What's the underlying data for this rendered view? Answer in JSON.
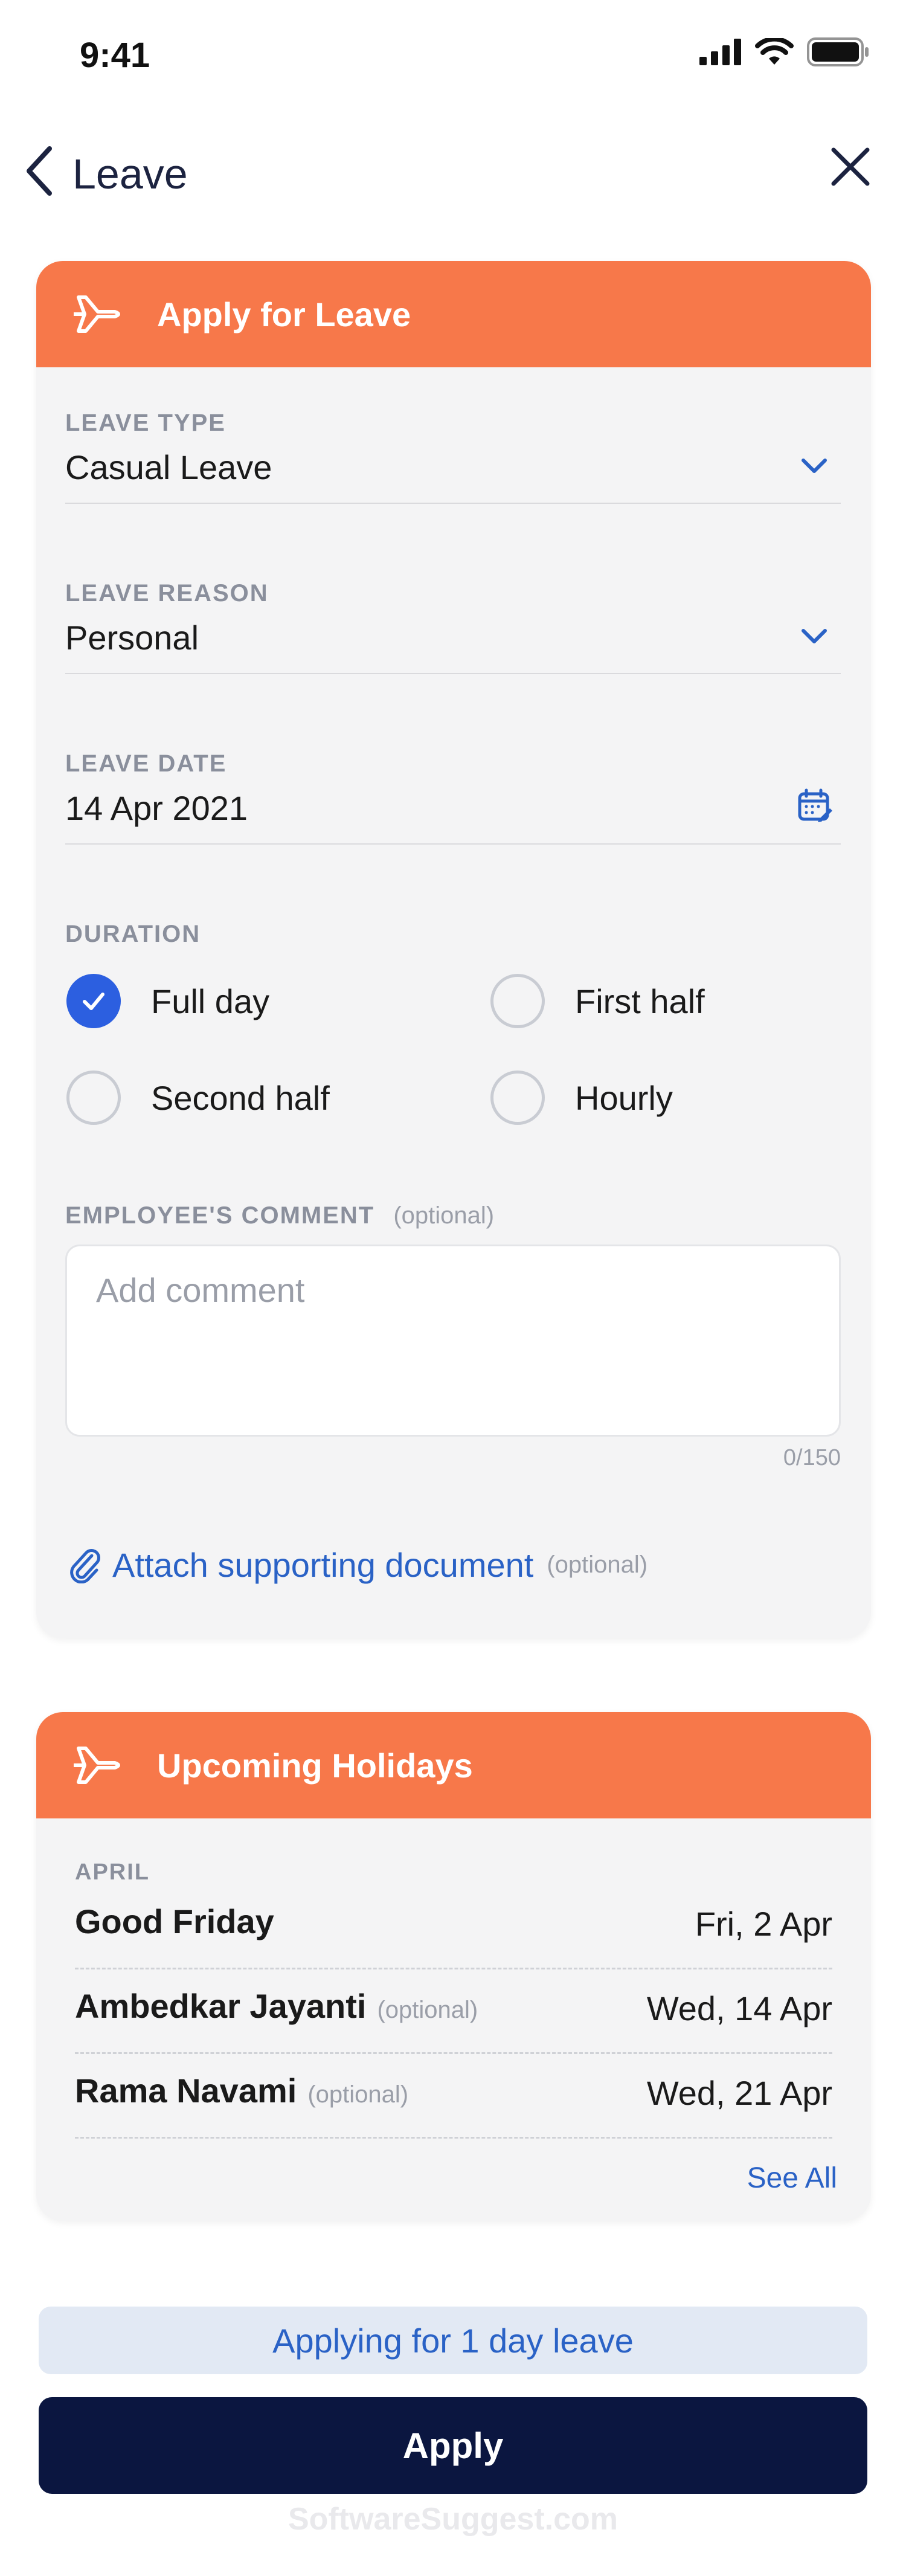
{
  "status_bar": {
    "time": "9:41"
  },
  "nav": {
    "title": "Leave"
  },
  "apply_card": {
    "title": "Apply for Leave",
    "leave_type": {
      "label": "LEAVE TYPE",
      "value": "Casual Leave"
    },
    "leave_reason": {
      "label": "LEAVE REASON",
      "value": "Personal"
    },
    "leave_date": {
      "label": "LEAVE DATE",
      "value": "14 Apr 2021"
    },
    "duration": {
      "label": "DURATION",
      "options": [
        {
          "label": "Full day",
          "checked": true
        },
        {
          "label": "First half",
          "checked": false
        },
        {
          "label": "Second half",
          "checked": false
        },
        {
          "label": "Hourly",
          "checked": false
        }
      ]
    },
    "comment": {
      "label": "EMPLOYEE'S COMMENT",
      "optional": "(optional)",
      "placeholder": "Add comment",
      "count": "0/150"
    },
    "attach": {
      "label": "Attach supporting document",
      "optional": "(optional)"
    }
  },
  "holidays_card": {
    "title": "Upcoming Holidays",
    "month": "APRIL",
    "items": [
      {
        "name": "Good Friday",
        "optional": "",
        "date": "Fri, 2 Apr"
      },
      {
        "name": "Ambedkar Jayanti",
        "optional": "(optional)",
        "date": "Wed, 14 Apr"
      },
      {
        "name": "Rama Navami",
        "optional": "(optional)",
        "date": "Wed, 21 Apr"
      }
    ],
    "see_all": "See All"
  },
  "summary": "Applying for 1 day leave",
  "apply_button": "Apply",
  "watermark": "SoftwareSuggest.com",
  "colors": {
    "accent_orange": "#f7784a",
    "primary_navy": "#0b1640",
    "link_blue": "#2a62c6",
    "check_blue": "#2c5fe0"
  }
}
